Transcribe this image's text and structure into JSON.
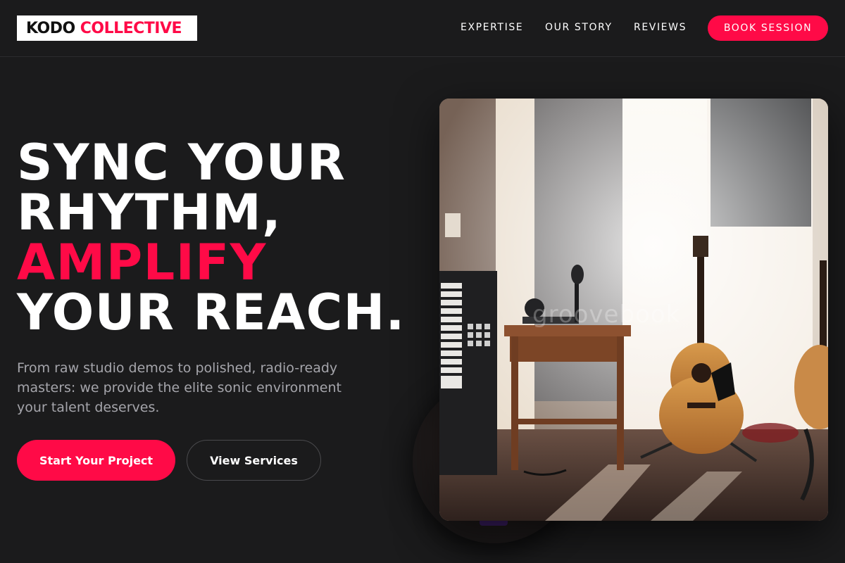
{
  "brand": {
    "word1": "KODO",
    "word2": "COLLECTIVE",
    "accent_color": "#ff0a47"
  },
  "nav": {
    "items": [
      {
        "label": "EXPERTISE"
      },
      {
        "label": "OUR STORY"
      },
      {
        "label": "REVIEWS"
      }
    ],
    "cta_label": "BOOK SESSION"
  },
  "hero": {
    "headline_line1": "SYNC YOUR",
    "headline_line2": "RHYTHM,",
    "headline_accent": "AMPLIFY",
    "headline_line4": "YOUR REACH.",
    "subtitle": "From raw studio demos to polished, radio-ready masters: we provide the elite sonic environment your talent deserves.",
    "primary_button": "Start Your Project",
    "secondary_button": "View Services"
  },
  "media": {
    "image_subject": "home music studio with acoustic guitars, keyboard, drum machine and microphone on a wooden table",
    "watermark": "groovebook"
  }
}
